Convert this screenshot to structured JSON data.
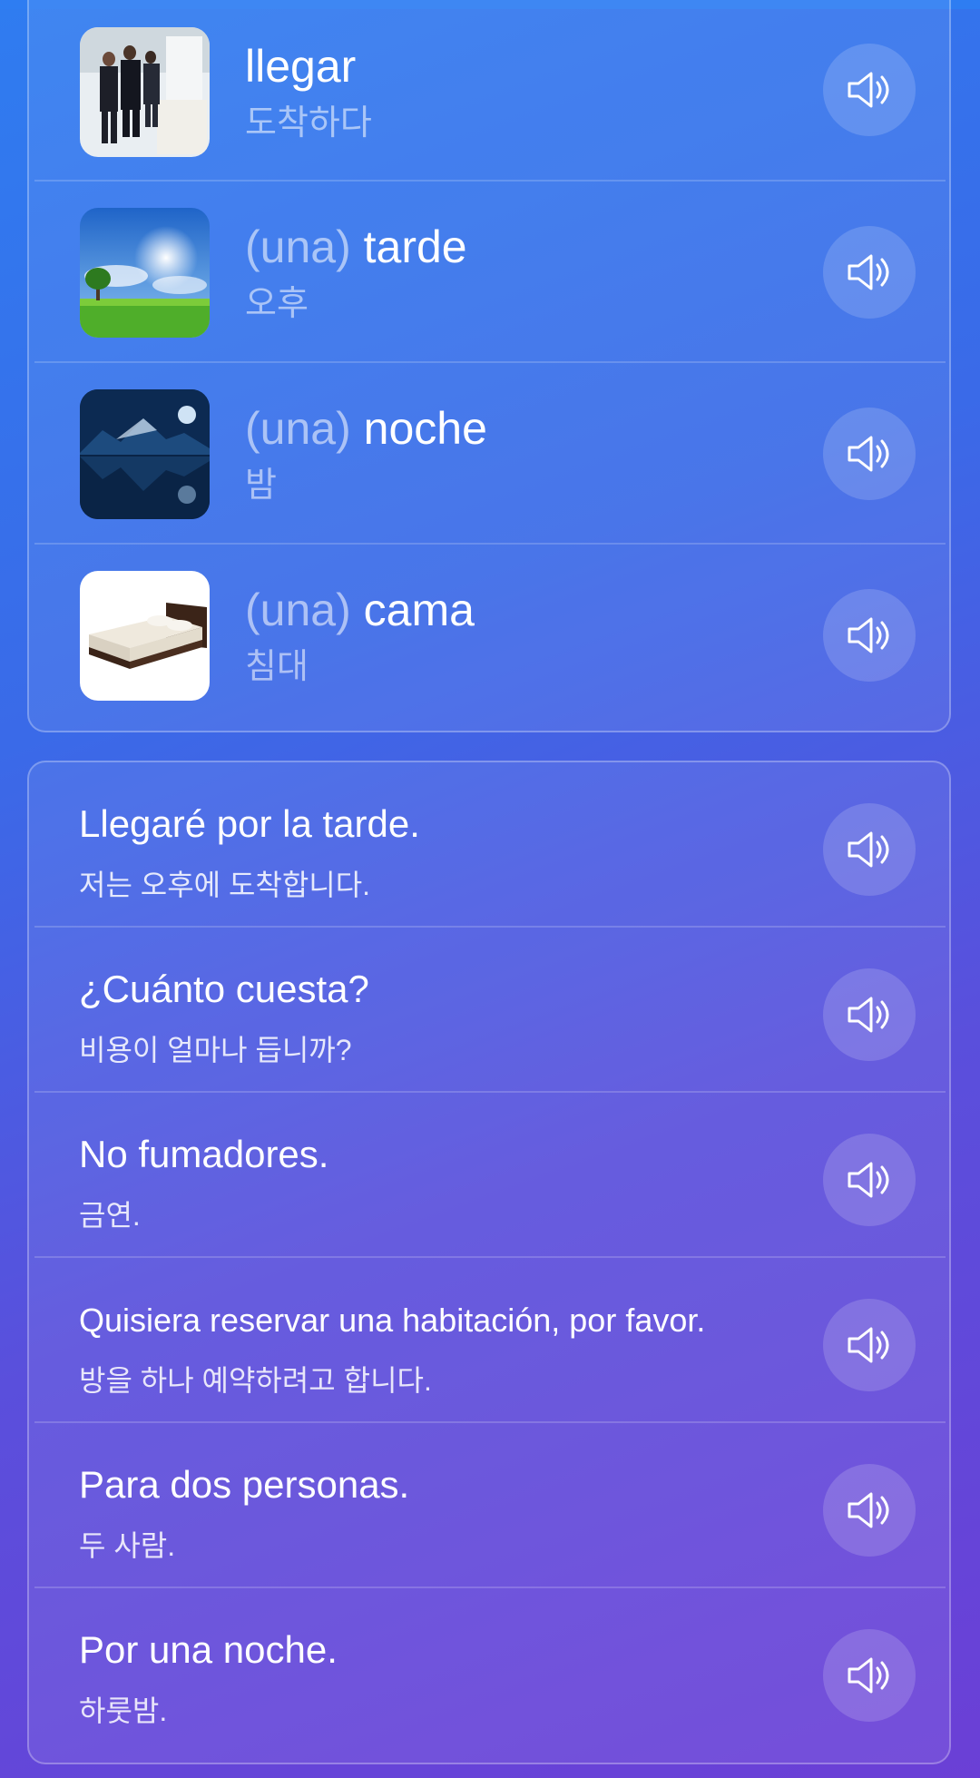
{
  "words": [
    {
      "article": "",
      "word": "llegar",
      "translation": "도착하다",
      "image": "people-walking-image"
    },
    {
      "article": "(una)",
      "word": "tarde",
      "translation": "오후",
      "image": "sunny-field-image"
    },
    {
      "article": "(una)",
      "word": "noche",
      "translation": "밤",
      "image": "night-lake-image"
    },
    {
      "article": "(una)",
      "word": "cama",
      "translation": "침대",
      "image": "bed-image"
    }
  ],
  "phrases": [
    {
      "text": "Llegaré por la tarde.",
      "translation": "저는 오후에 도착합니다."
    },
    {
      "text": "¿Cuánto cuesta?",
      "translation": "비용이 얼마나 듭니까?"
    },
    {
      "text": "No fumadores.",
      "translation": "금연."
    },
    {
      "text": "Quisiera reservar una habitación, por favor.",
      "translation": "방을 하나 예약하려고 합니다."
    },
    {
      "text": "Para dos personas.",
      "translation": "두 사람."
    },
    {
      "text": "Por una noche.",
      "translation": "하룻밤."
    }
  ],
  "icons": {
    "speaker": "speaker-icon"
  },
  "colors": {
    "bg_top": "#2f7cf0",
    "bg_bottom": "#6b3fd6",
    "article": "rgba(255,255,255,0.55)"
  }
}
